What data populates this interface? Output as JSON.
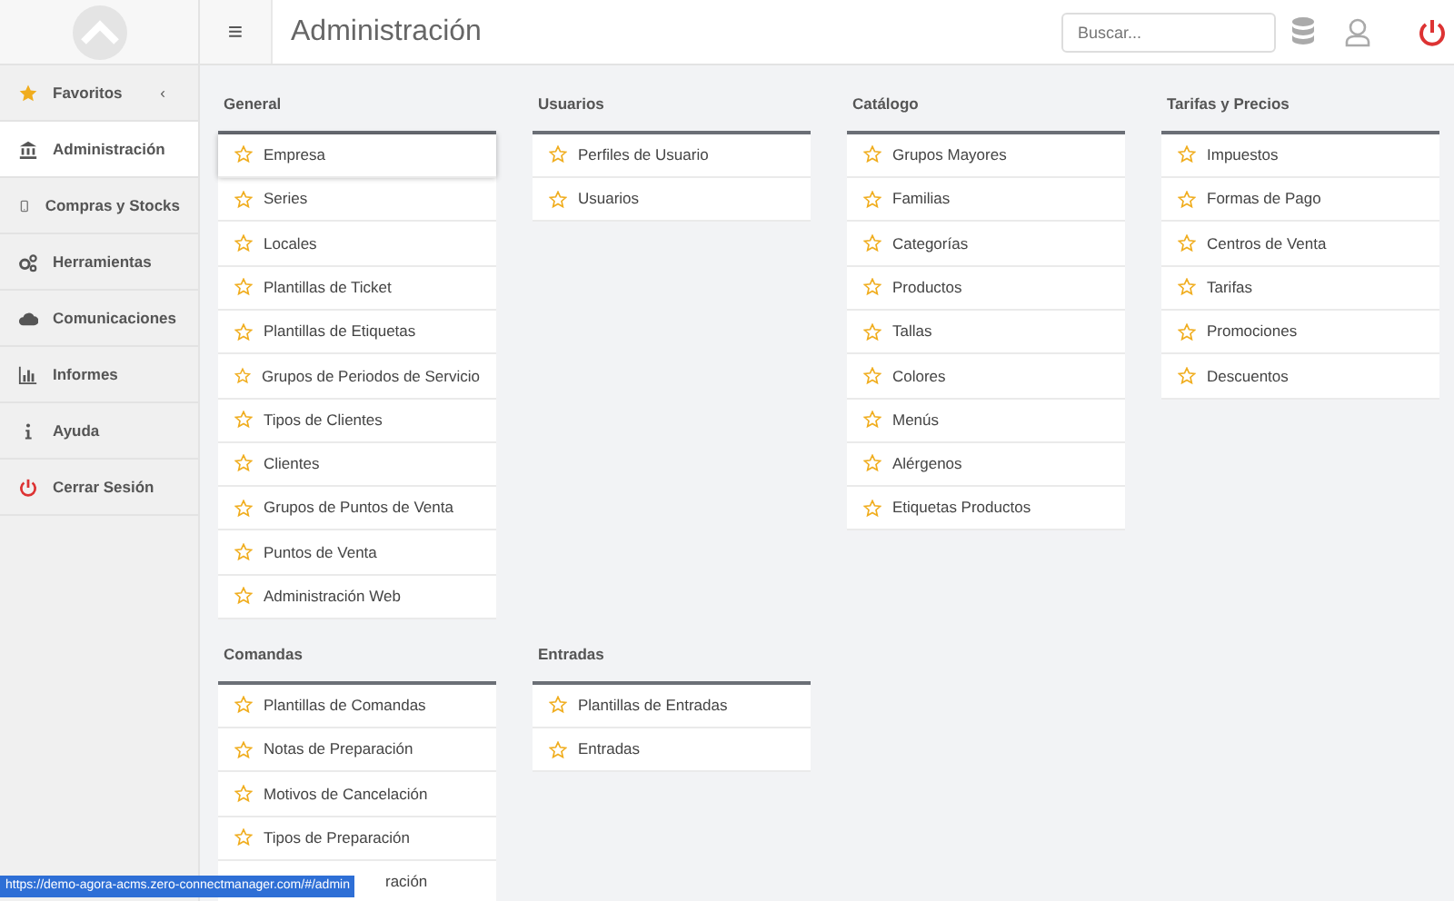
{
  "header": {
    "menu_glyph": "≡",
    "title": "Administración",
    "search": {
      "placeholder": "Buscar..."
    }
  },
  "sidebar": {
    "items": [
      {
        "label": "Favoritos",
        "selected": false,
        "caret": "‹"
      },
      {
        "label": "Administración",
        "selected": true
      },
      {
        "label": "Compras y Stocks",
        "selected": false
      },
      {
        "label": "Herramientas",
        "selected": false
      },
      {
        "label": "Comunicaciones",
        "selected": false
      },
      {
        "label": "Informes",
        "selected": false
      },
      {
        "label": "Ayuda",
        "selected": false
      },
      {
        "label": "Cerrar Sesión",
        "selected": false
      }
    ]
  },
  "sections": [
    {
      "title": "General",
      "items": [
        {
          "label": "Empresa",
          "hovered": true
        },
        {
          "label": "Series"
        },
        {
          "label": "Locales"
        },
        {
          "label": "Plantillas de Ticket"
        },
        {
          "label": "Plantillas de Etiquetas"
        },
        {
          "label": "Grupos de Periodos de Servicio"
        },
        {
          "label": "Tipos de Clientes"
        },
        {
          "label": "Clientes"
        },
        {
          "label": "Grupos de Puntos de Venta"
        },
        {
          "label": "Puntos de Venta"
        },
        {
          "label": "Administración Web"
        }
      ]
    },
    {
      "title": "Usuarios",
      "items": [
        {
          "label": "Perfiles de Usuario"
        },
        {
          "label": "Usuarios"
        }
      ]
    },
    {
      "title": "Catálogo",
      "items": [
        {
          "label": "Grupos Mayores"
        },
        {
          "label": "Familias"
        },
        {
          "label": "Categorías"
        },
        {
          "label": "Productos"
        },
        {
          "label": "Tallas"
        },
        {
          "label": "Colores"
        },
        {
          "label": "Menús"
        },
        {
          "label": "Alérgenos"
        },
        {
          "label": "Etiquetas Productos"
        }
      ]
    },
    {
      "title": "Tarifas y Precios",
      "items": [
        {
          "label": "Impuestos"
        },
        {
          "label": "Formas de Pago"
        },
        {
          "label": "Centros de Venta"
        },
        {
          "label": "Tarifas"
        },
        {
          "label": "Promociones"
        },
        {
          "label": "Descuentos"
        }
      ]
    },
    {
      "title": "Comandas",
      "items": [
        {
          "label": "Plantillas de Comandas"
        },
        {
          "label": "Notas de Preparación"
        },
        {
          "label": "Motivos de Cancelación"
        },
        {
          "label": "Tipos de Preparación"
        },
        {
          "label": "ración",
          "covered": true
        }
      ]
    },
    {
      "title": "Entradas",
      "items": [
        {
          "label": "Plantillas de Entradas"
        },
        {
          "label": "Entradas"
        }
      ]
    }
  ],
  "status_url": "https://demo-agora-acms.zero-connectmanager.com/#/admin"
}
